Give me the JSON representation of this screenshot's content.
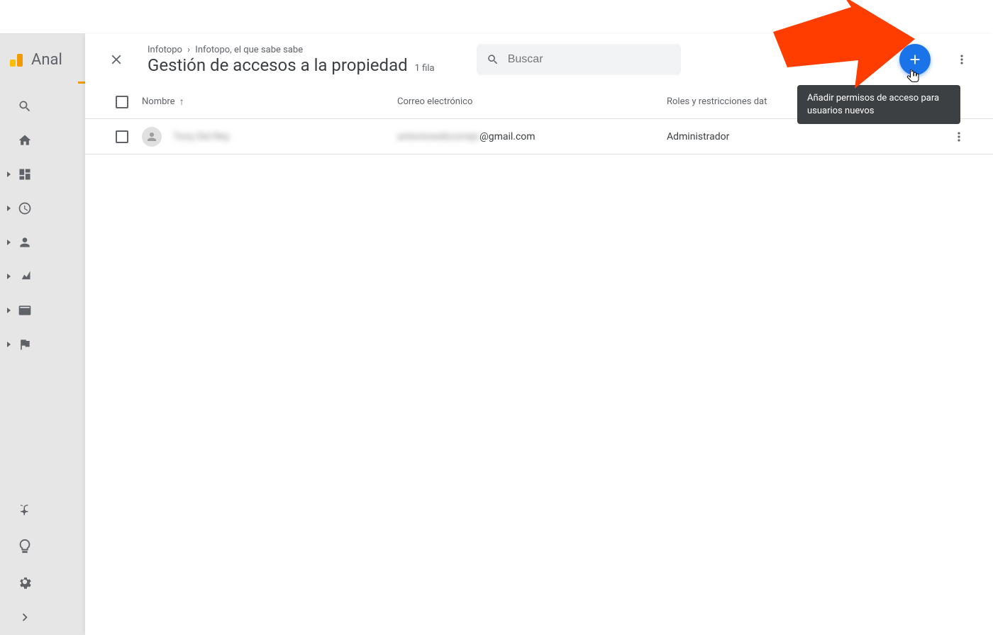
{
  "app": {
    "name_truncated": "Anal"
  },
  "panel": {
    "breadcrumb": {
      "account": "Infotopo",
      "property": "Infotopo, el que sabe sabe"
    },
    "title": "Gestión de accesos a la propiedad",
    "row_count_label": "1 fila",
    "search_placeholder": "Buscar"
  },
  "table": {
    "columns": {
      "name": "Nombre",
      "email": "Correo electrónico",
      "roles": "Roles y restricciones dat"
    },
    "rows": [
      {
        "name_blurred": "Tony Del Rey",
        "email_blurred_prefix": "antoniowebcorrejo",
        "email_suffix": "@gmail.com",
        "role": "Administrador"
      }
    ]
  },
  "tooltip": {
    "text": "Añadir permisos de acceso para usuarios nuevos"
  }
}
